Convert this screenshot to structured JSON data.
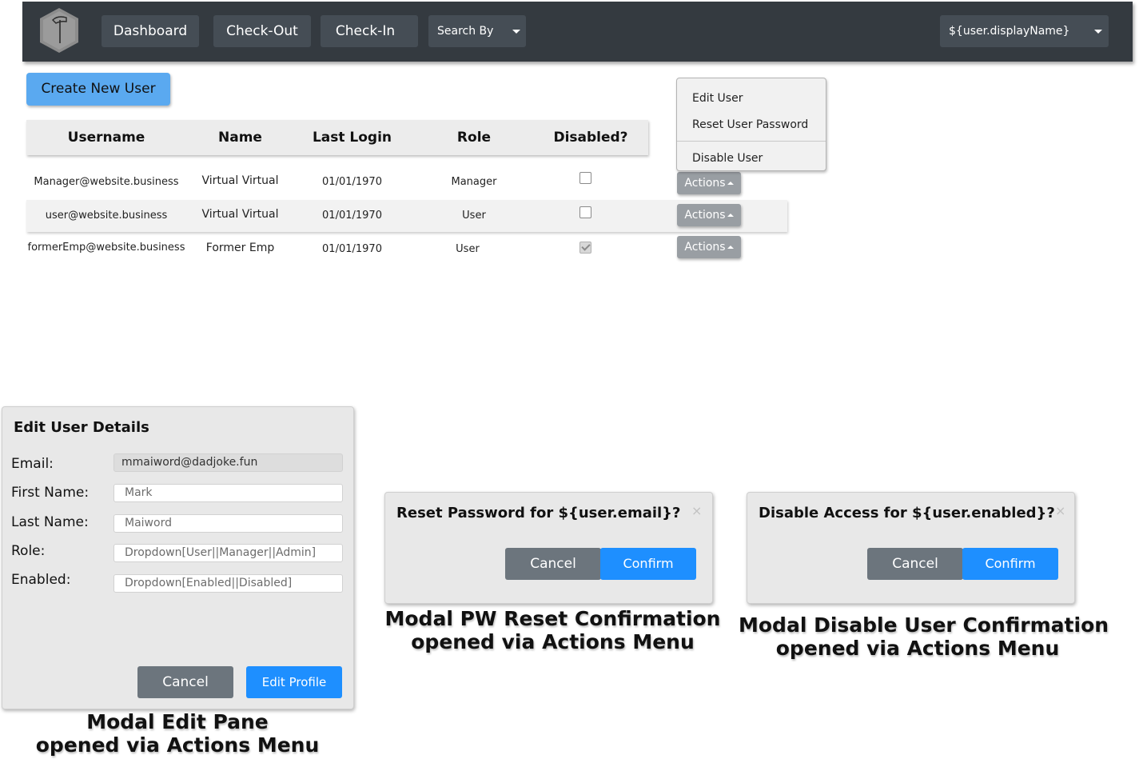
{
  "navbar": {
    "logo_icon": "hammer-hexagon-icon",
    "dashboard_label": "Dashboard",
    "checkout_label": "Check-Out",
    "checkin_label": "Check-In",
    "search_by_label": "Search By",
    "user_menu_label": "${user.displayName}"
  },
  "toolbar": {
    "create_user_label": "Create New User"
  },
  "table": {
    "headers": [
      "Username",
      "Name",
      "Last Login",
      "Role",
      "Disabled?"
    ],
    "rows": [
      {
        "username": "Manager@website.business",
        "name": "Virtual Virtual",
        "last_login": "01/01/1970",
        "role": "Manager",
        "disabled": false,
        "actions_label": "Actions"
      },
      {
        "username": "user@website.business",
        "name": "Virtual Virtual",
        "last_login": "01/01/1970",
        "role": "User",
        "disabled": false,
        "actions_label": "Actions"
      },
      {
        "username": "formerEmp@website.business",
        "name": "Former Emp",
        "last_login": "01/01/1970",
        "role": "User",
        "disabled": true,
        "actions_label": "Actions"
      }
    ]
  },
  "actions_menu": {
    "items": [
      "Edit User",
      "Reset User Password",
      "Disable User"
    ]
  },
  "edit_modal": {
    "title": "Edit User Details",
    "labels": {
      "email": "Email:",
      "first_name": "First Name:",
      "last_name": "Last Name:",
      "role": "Role:",
      "enabled": "Enabled:"
    },
    "values": {
      "email": "mmaiword@dadjoke.fun"
    },
    "placeholders": {
      "first_name": "Mark",
      "last_name": "Maiword",
      "role": "Dropdown[User||Manager||Admin]",
      "enabled": "Dropdown[Enabled||Disabled]"
    },
    "cancel_label": "Cancel",
    "submit_label": "Edit Profile",
    "caption_line1": "Modal Edit Pane",
    "caption_line2": "opened via Actions Menu"
  },
  "reset_modal": {
    "title": "Reset Password for ${user.email}?",
    "close_label": "×",
    "cancel_label": "Cancel",
    "confirm_label": "Confirm",
    "caption_line1": "Modal PW Reset Confirmation",
    "caption_line2": "opened via Actions Menu"
  },
  "disable_modal": {
    "title": "Disable Access for ${user.enabled}?",
    "close_label": "×",
    "cancel_label": "Cancel",
    "confirm_label": "Confirm",
    "caption_line1": "Modal Disable User Confirmation",
    "caption_line2": "opened via Actions Menu"
  },
  "colors": {
    "navbar": "#343a40",
    "nav_button": "#454d55",
    "primary": "#1e8fff",
    "create_button": "#5aa9f0",
    "secondary": "#6c757d",
    "actions_button": "#999ea3"
  }
}
